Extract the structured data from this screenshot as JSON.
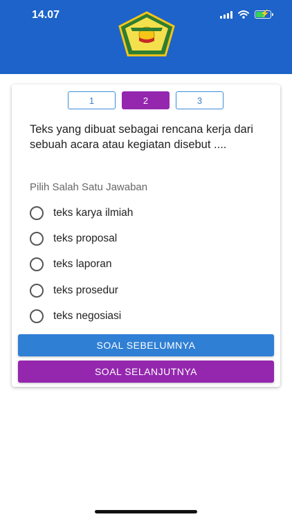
{
  "status_bar": {
    "time": "14.07",
    "icons": [
      "signal-icon",
      "wifi-icon",
      "battery-charging-icon"
    ]
  },
  "header": {
    "background_color": "#1d63c9",
    "logo": "school-emblem-logo"
  },
  "pager": {
    "pages": [
      "1",
      "2",
      "3"
    ],
    "active_index": 1
  },
  "question": {
    "text": "Teks yang dibuat sebagai rencana kerja dari sebuah acara atau kegiatan disebut ...."
  },
  "answers": {
    "prompt": "Pilih Salah Satu Jawaban",
    "options": [
      "teks karya ilmiah",
      "teks proposal",
      "teks laporan",
      "teks prosedur",
      "teks negosiasi"
    ]
  },
  "navigation": {
    "prev_label": "SOAL SEBELUMNYA",
    "next_label": "SOAL SELANJUTNYA"
  },
  "colors": {
    "primary": "#2f7fd4",
    "accent": "#9427ae"
  }
}
